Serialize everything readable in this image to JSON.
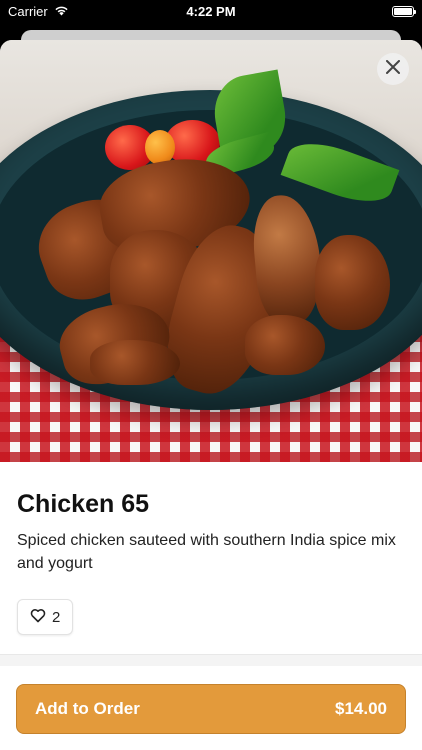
{
  "status_bar": {
    "carrier": "Carrier",
    "time": "4:22 PM",
    "wifi_icon": "wifi-icon",
    "battery_icon": "battery-icon"
  },
  "hero": {
    "close_icon": "close-icon"
  },
  "dish": {
    "title": "Chicken 65",
    "description": "Spiced chicken sauteed with southern India spice mix and yogurt",
    "like_count": "2",
    "like_icon": "heart-icon"
  },
  "order": {
    "label": "Add to Order",
    "price": "$14.00"
  },
  "colors": {
    "accent": "#e39a3b"
  }
}
